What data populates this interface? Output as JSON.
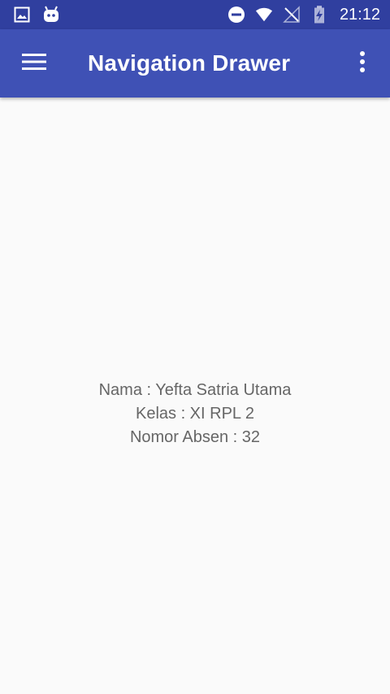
{
  "status_bar": {
    "time": "21:12",
    "icons_left": [
      "gallery-icon",
      "android-icon"
    ],
    "icons_right": [
      "do-not-disturb-icon",
      "wifi-icon",
      "no-signal-icon",
      "battery-charging-icon"
    ]
  },
  "app_bar": {
    "title": "Navigation Drawer",
    "menu_icon": "hamburger-menu-icon",
    "overflow_icon": "more-vert-icon"
  },
  "content": {
    "nama": "Nama : Yefta Satria Utama",
    "kelas": "Kelas : XI RPL 2",
    "nomor_absen": "Nomor Absen : 32"
  },
  "colors": {
    "status_bar": "#303f9f",
    "app_bar": "#3f51b5",
    "background": "#fafafa",
    "text": "#666666"
  }
}
